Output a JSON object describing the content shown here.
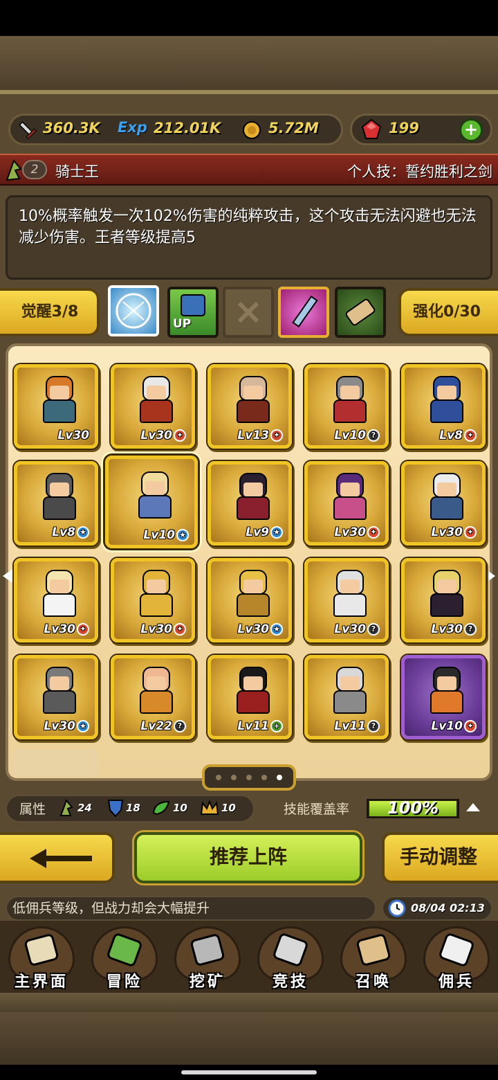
{
  "resources": {
    "attack": "360.3K",
    "exp": "212.01K",
    "gold": "5.72M",
    "gems": "199",
    "exp_icon_label": "Exp"
  },
  "hero": {
    "rank": "2",
    "name": "骑士王",
    "skill_title": "个人技：誓约胜利之剑",
    "description": "10%概率触发一次102%伤害的纯粹攻击，这个攻击无法闪避也无法减少伤害。王者等级提高5"
  },
  "skill_row": {
    "awaken_label": "觉醒3/8",
    "enhance_label": "强化0/30",
    "up_label": "UP"
  },
  "grid": [
    [
      {
        "lv": "Lv30",
        "badge": "",
        "badge_glyph": "",
        "hair": "#d8792a",
        "body": "#3d6a7a"
      },
      {
        "lv": "Lv30",
        "badge": "fire",
        "badge_glyph": "✦",
        "hair": "#e8e8e8",
        "body": "#a8341e"
      },
      {
        "lv": "Lv13",
        "badge": "fire",
        "badge_glyph": "✦",
        "hair": "#d6b79a",
        "body": "#7a2a1a"
      },
      {
        "lv": "Lv10",
        "badge": "q",
        "badge_glyph": "?",
        "hair": "#8a8a8a",
        "body": "#b32e2e"
      },
      {
        "lv": "Lv8",
        "badge": "fire",
        "badge_glyph": "✦",
        "hair": "#2f4f9a",
        "body": "#2f4f9a"
      }
    ],
    [
      {
        "lv": "Lv8",
        "badge": "star",
        "badge_glyph": "★",
        "hair": "#5a5a5a",
        "body": "#4a4a4a"
      },
      {
        "lv": "Lv10",
        "badge": "star",
        "badge_glyph": "★",
        "hair": "#f1dc9c",
        "body": "#5c78b8"
      },
      {
        "lv": "Lv9",
        "badge": "star",
        "badge_glyph": "★",
        "hair": "#2a2030",
        "body": "#8a1f2e"
      },
      {
        "lv": "Lv30",
        "badge": "fire",
        "badge_glyph": "✦",
        "hair": "#5a2a7a",
        "body": "#c8508a"
      },
      {
        "lv": "Lv30",
        "badge": "fire",
        "badge_glyph": "✦",
        "hair": "#ececec",
        "body": "#3a5a8a"
      }
    ],
    [
      {
        "lv": "Lv30",
        "badge": "fire",
        "badge_glyph": "✦",
        "hair": "#f3e4b0",
        "body": "#f4f4f4"
      },
      {
        "lv": "Lv30",
        "badge": "fire",
        "badge_glyph": "✦",
        "hair": "#e2b43a",
        "body": "#e2b43a"
      },
      {
        "lv": "Lv30",
        "badge": "star",
        "badge_glyph": "★",
        "hair": "#e8c048",
        "body": "#b8862a"
      },
      {
        "lv": "Lv30",
        "badge": "q",
        "badge_glyph": "?",
        "hair": "#e0e0e0",
        "body": "#e8e8e8"
      },
      {
        "lv": "Lv30",
        "badge": "q",
        "badge_glyph": "?",
        "hair": "#e6d16a",
        "body": "#2a2030"
      }
    ],
    [
      {
        "lv": "Lv30",
        "badge": "star",
        "badge_glyph": "★",
        "hair": "#7a7a7a",
        "body": "#5a5a5a"
      },
      {
        "lv": "Lv22",
        "badge": "q",
        "badge_glyph": "?",
        "hair": "#f0b890",
        "body": "#d88a2a"
      },
      {
        "lv": "Lv11",
        "badge": "plus",
        "badge_glyph": "+",
        "hair": "#1a1a1a",
        "body": "#9a2020"
      },
      {
        "lv": "Lv11",
        "badge": "q",
        "badge_glyph": "?",
        "hair": "#d8d8d8",
        "body": "#8a8a8a"
      },
      {
        "lv": "Lv10",
        "badge": "fire",
        "badge_glyph": "✦",
        "hair": "#2a2a2a",
        "body": "#e07a2a"
      }
    ]
  ],
  "attributes": {
    "label": "属性",
    "values": [
      "24",
      "18",
      "10",
      "10"
    ],
    "coverage_label": "技能覆盖率",
    "coverage_value": "100%",
    "coverage_fraction": 1.0
  },
  "buttons": {
    "recommend": "推荐上阵",
    "manual": "手动调整"
  },
  "message": "低佣兵等级，但战力却会大幅提升",
  "time": "08/04 02:13",
  "nav": [
    {
      "label": "主界面",
      "icon": "map-scroll-icon"
    },
    {
      "label": "冒险",
      "icon": "island-icon"
    },
    {
      "label": "挖矿",
      "icon": "pickaxe-icon"
    },
    {
      "label": "竞技",
      "icon": "crossed-swords-icon"
    },
    {
      "label": "召唤",
      "icon": "summon-scroll-icon"
    },
    {
      "label": "佣兵",
      "icon": "tent-icon"
    }
  ],
  "colors": {
    "accent_gold": "#efc424",
    "title_red": "#8a2a1e",
    "button_green": "#a6d82a"
  }
}
